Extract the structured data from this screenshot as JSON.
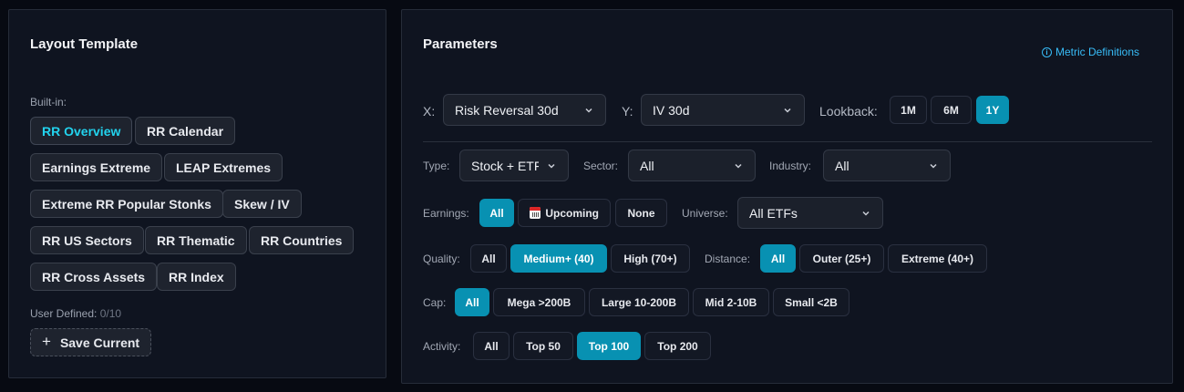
{
  "layout": {
    "title": "Layout Template",
    "builtin_label": "Built-in:",
    "templates": [
      "RR Overview",
      "RR Calendar",
      "Earnings Extreme",
      "LEAP Extremes",
      "Extreme RR Popular Stonks",
      "Skew / IV",
      "RR US Sectors",
      "RR Thematic",
      "RR Countries",
      "RR Cross Assets",
      "RR Index"
    ],
    "active_template": "RR Overview",
    "user_defined_label": "User Defined:",
    "user_defined_count": "0/10",
    "save_label": "Save Current"
  },
  "params": {
    "title": "Parameters",
    "metric_link": "Metric Definitions",
    "x_label": "X:",
    "x_value": "Risk Reversal 30d",
    "y_label": "Y:",
    "y_value": "IV 30d",
    "lookback_label": "Lookback:",
    "lookback_options": [
      "1M",
      "6M",
      "1Y"
    ],
    "type_label": "Type:",
    "type_value": "Stock + ETF",
    "sector_label": "Sector:",
    "sector_value": "All",
    "industry_label": "Industry:",
    "industry_value": "All",
    "earnings_label": "Earnings:",
    "earnings_options": [
      "All",
      "Upcoming",
      "None"
    ],
    "universe_label": "Universe:",
    "universe_value": "All ETFs",
    "quality_label": "Quality:",
    "quality_options": [
      "All",
      "Medium+ (40)",
      "High (70+)"
    ],
    "distance_label": "Distance:",
    "distance_options": [
      "All",
      "Outer (25+)",
      "Extreme (40+)"
    ],
    "cap_label": "Cap:",
    "cap_options": [
      "All",
      "Mega >200B",
      "Large 10-200B",
      "Mid 2-10B",
      "Small <2B"
    ],
    "activity_label": "Activity:",
    "activity_options": [
      "All",
      "Top 50",
      "Top 100",
      "Top 200"
    ],
    "selected": {
      "lookback": "1Y",
      "earnings": "All",
      "quality": "Medium+ (40)",
      "distance": "All",
      "cap": "All",
      "activity": "Top 100"
    }
  },
  "colors": {
    "accent": "#0891b2",
    "active_text": "#22d3ee",
    "link": "#38bdf8"
  },
  "icons": {
    "info": "info-circle-icon",
    "calendar": "calendar-icon",
    "chevron": "chevron-down-icon",
    "plus": "plus-icon"
  }
}
